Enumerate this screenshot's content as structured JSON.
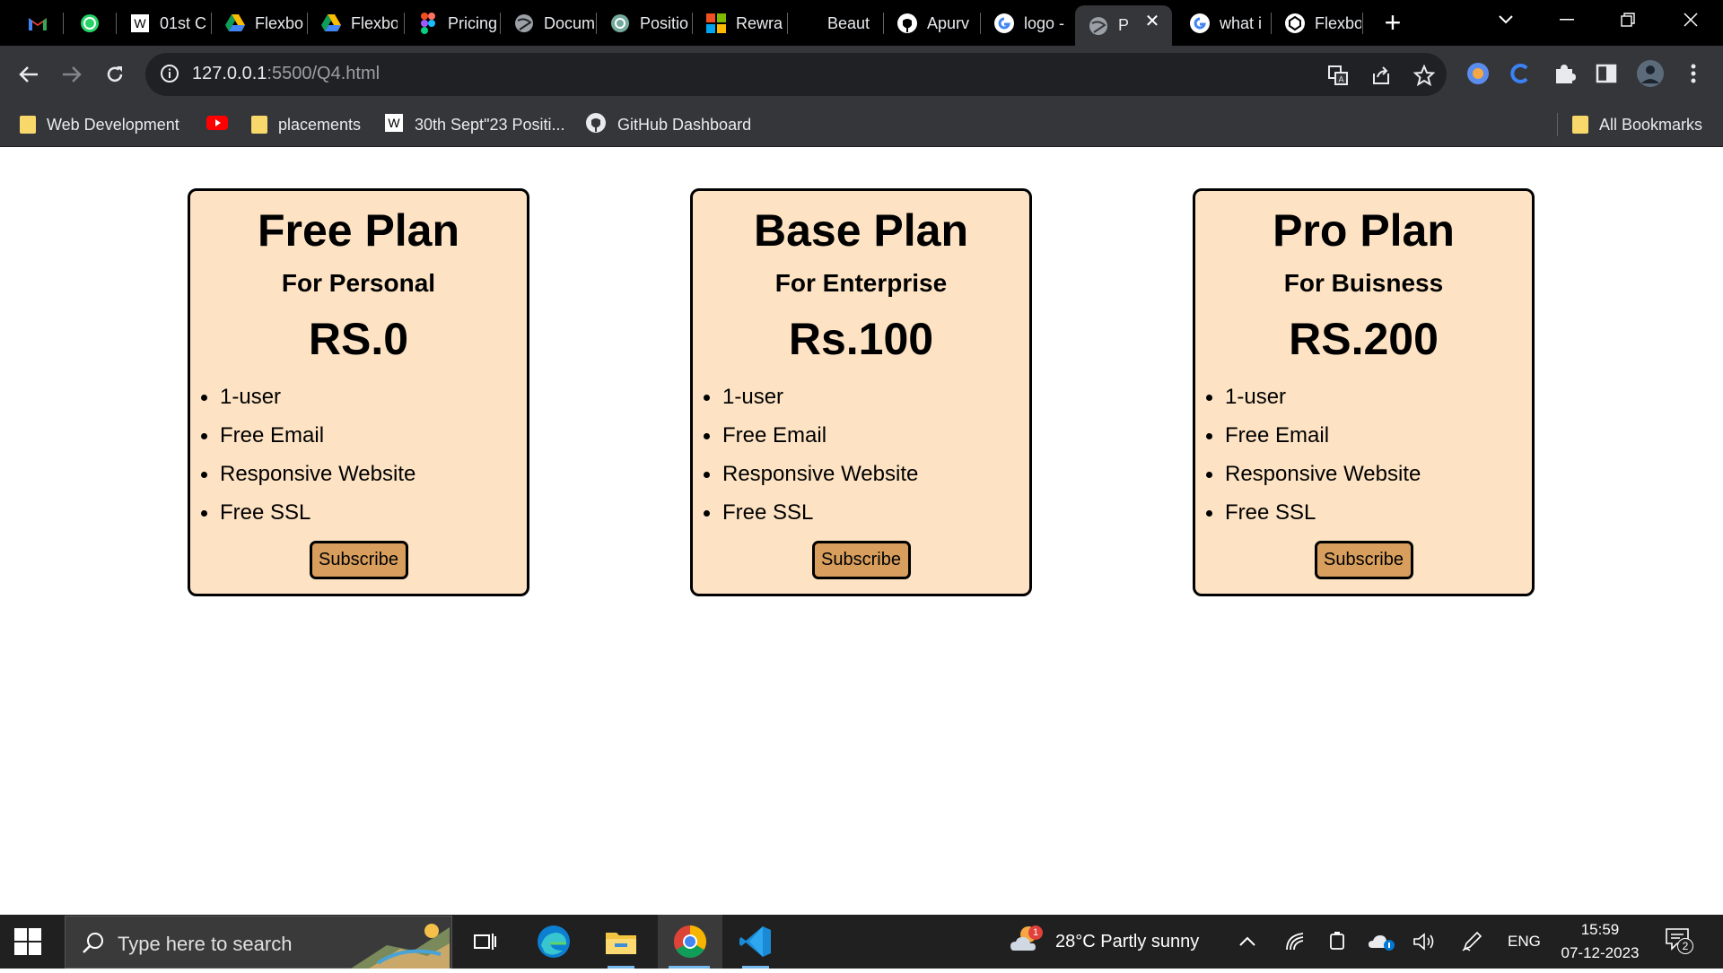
{
  "browser": {
    "tabs": [
      {
        "label": "",
        "icon": "gmail-icon"
      },
      {
        "label": "",
        "icon": "whatsapp-icon"
      },
      {
        "label": "01st C",
        "icon": "wordpress-icon"
      },
      {
        "label": "Flexbo",
        "icon": "google-drive-icon"
      },
      {
        "label": "Flexbo",
        "icon": "google-drive-icon"
      },
      {
        "label": "Pricing",
        "icon": "figma-icon"
      },
      {
        "label": "Docum",
        "icon": "globe-icon"
      },
      {
        "label": "Positio",
        "icon": "chatgpt-icon"
      },
      {
        "label": "Rewra",
        "icon": "microsoft-icon"
      },
      {
        "label": "Beaut",
        "icon": ""
      },
      {
        "label": "Apurv",
        "icon": "github-icon"
      },
      {
        "label": "logo -",
        "icon": "google-icon"
      },
      {
        "label": "P",
        "icon": "globe-icon",
        "active": true
      },
      {
        "label": "what i",
        "icon": "google-icon"
      },
      {
        "label": "Flexbo",
        "icon": "codepen-icon"
      }
    ],
    "address": {
      "host": "127.0.0.1",
      "path": ":5500/Q4.html"
    },
    "bookmarks": [
      {
        "label": "Web Development",
        "icon": "folder-icon"
      },
      {
        "label": "",
        "icon": "youtube-icon"
      },
      {
        "label": "placements",
        "icon": "folder-icon"
      },
      {
        "label": "30th Sept\"23 Positi...",
        "icon": "wordpress-icon"
      },
      {
        "label": "GitHub Dashboard",
        "icon": "github-icon"
      }
    ],
    "all_bookmarks_label": "All Bookmarks"
  },
  "plans": [
    {
      "title": "Free Plan",
      "subtitle": "For Personal",
      "price": "RS.0",
      "features": [
        "1-user",
        "Free Email",
        "Responsive Website",
        "Free SSL"
      ],
      "button": "Subscribe"
    },
    {
      "title": "Base Plan",
      "subtitle": "For Enterprise",
      "price": "Rs.100",
      "features": [
        "1-user",
        "Free Email",
        "Responsive Website",
        "Free SSL"
      ],
      "button": "Subscribe"
    },
    {
      "title": "Pro Plan",
      "subtitle": "For Buisness",
      "price": "RS.200",
      "features": [
        "1-user",
        "Free Email",
        "Responsive Website",
        "Free SSL"
      ],
      "button": "Subscribe"
    }
  ],
  "taskbar": {
    "search_placeholder": "Type here to search",
    "weather": "28°C  Partly sunny",
    "weather_badge": "1",
    "language": "ENG",
    "time": "15:59",
    "date": "07-12-2023",
    "notification_count": "2"
  },
  "colors": {
    "card_bg": "#fde3c3",
    "button_bg": "#d89e5d",
    "browser_frame": "#35363a",
    "tab_strip": "#000000"
  }
}
